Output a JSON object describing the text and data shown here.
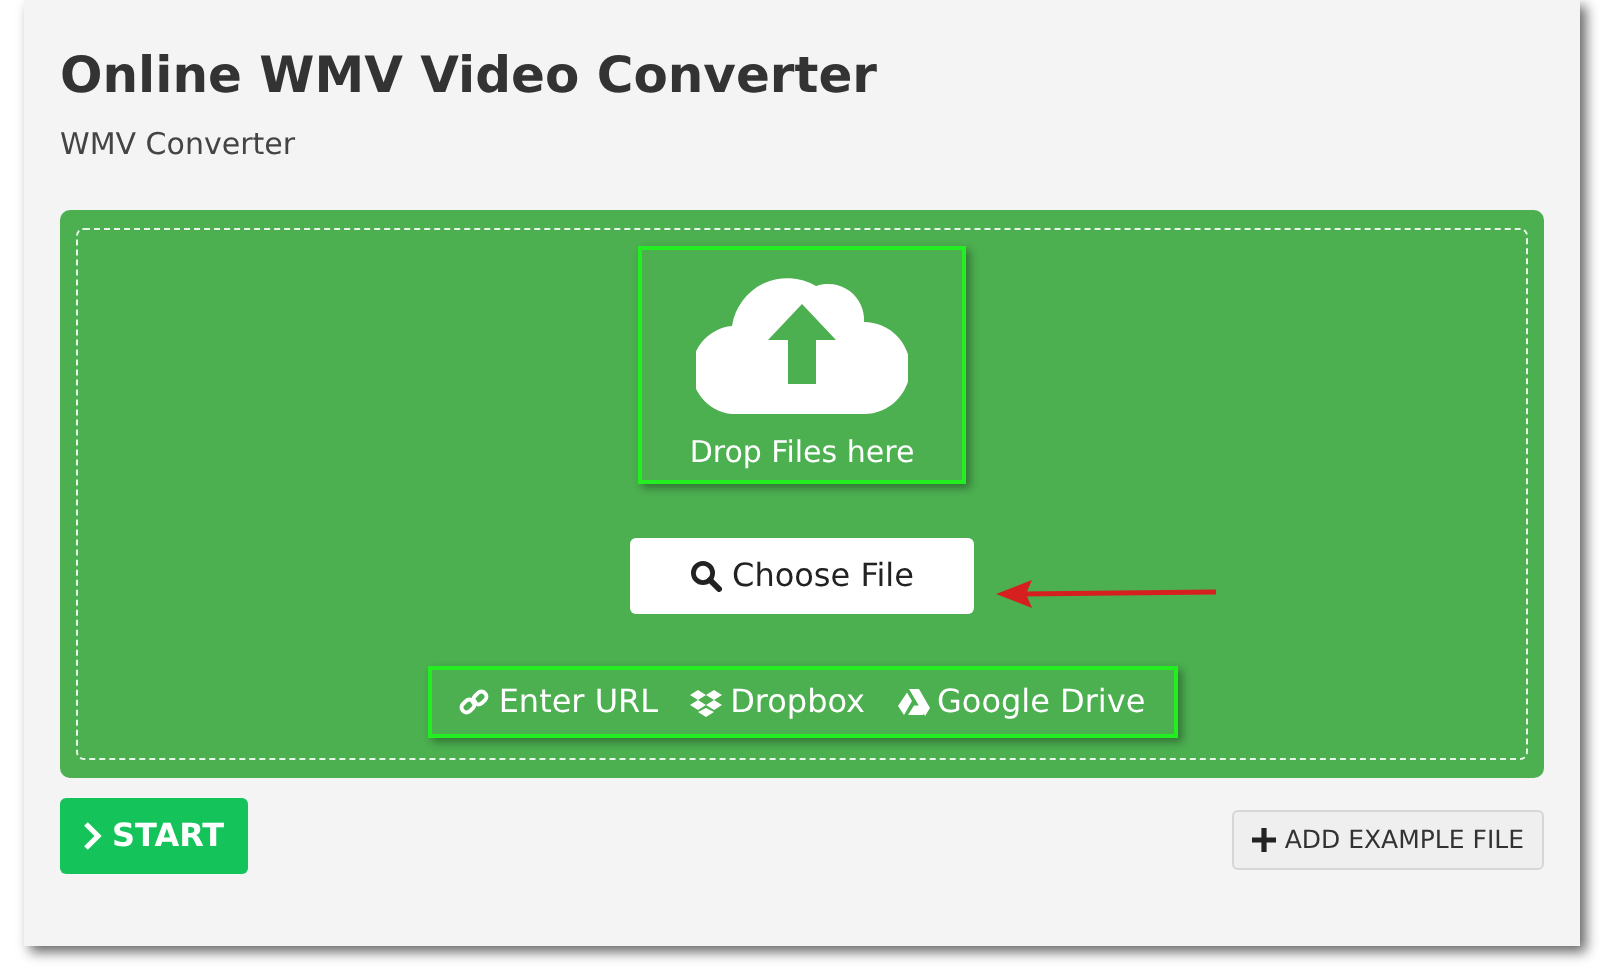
{
  "title": "Online WMV Video Converter",
  "subtitle": "WMV Converter",
  "drop_zone": {
    "label": "Drop Files here"
  },
  "choose_button": "Choose File",
  "sources": [
    {
      "kind": "url",
      "label": "Enter URL"
    },
    {
      "kind": "dropbox",
      "label": "Dropbox"
    },
    {
      "kind": "drive",
      "label": "Google Drive"
    }
  ],
  "start_button": "START",
  "example_button": "ADD EXAMPLE FILE"
}
